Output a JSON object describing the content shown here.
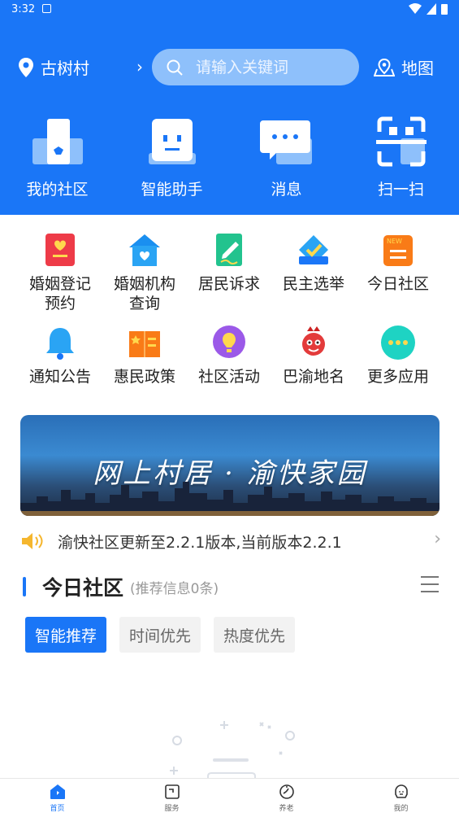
{
  "status_bar": {
    "time": "3:32"
  },
  "location": {
    "name": "古树村",
    "arrow": "›"
  },
  "search": {
    "placeholder": "请输入关键词"
  },
  "map": {
    "label": "地图"
  },
  "quick_actions": [
    {
      "label": "我的社区",
      "icon": "my-community-icon"
    },
    {
      "label": "智能助手",
      "icon": "robot-icon"
    },
    {
      "label": "消息",
      "icon": "message-icon"
    },
    {
      "label": "扫一扫",
      "icon": "scan-icon"
    }
  ],
  "grid": {
    "row1": [
      {
        "label": "婚姻登记\n预约",
        "icon": "marriage-register-icon"
      },
      {
        "label": "婚姻机构\n查询",
        "icon": "marriage-agency-icon"
      },
      {
        "label": "居民诉求",
        "icon": "appeal-icon"
      },
      {
        "label": "民主选举",
        "icon": "election-icon"
      },
      {
        "label": "今日社区",
        "icon": "today-community-icon"
      }
    ],
    "row2": [
      {
        "label": "通知公告",
        "icon": "bell-icon"
      },
      {
        "label": "惠民政策",
        "icon": "policy-icon"
      },
      {
        "label": "社区活动",
        "icon": "activity-icon"
      },
      {
        "label": "巴渝地名",
        "icon": "mascot-icon"
      },
      {
        "label": "更多应用",
        "icon": "more-icon"
      }
    ]
  },
  "banner": {
    "title": "网上村居 · 渝快家园"
  },
  "notice": {
    "text": "渝快社区更新至2.2.1版本,当前版本2.2.1",
    "chevron": "›"
  },
  "section": {
    "title": "今日社区",
    "subtitle": "(推荐信息0条)"
  },
  "filters": [
    {
      "label": "智能推荐",
      "active": true
    },
    {
      "label": "时间优先",
      "active": false
    },
    {
      "label": "热度优先",
      "active": false
    }
  ],
  "tabbar": [
    {
      "label": "首页",
      "active": true,
      "icon": "home-icon"
    },
    {
      "label": "服务",
      "active": false,
      "icon": "service-icon"
    },
    {
      "label": "养老",
      "active": false,
      "icon": "elderly-icon"
    },
    {
      "label": "我的",
      "active": false,
      "icon": "profile-icon"
    }
  ],
  "colors": {
    "primary": "#1a76f7",
    "search_bg": "#8ec0fb"
  }
}
